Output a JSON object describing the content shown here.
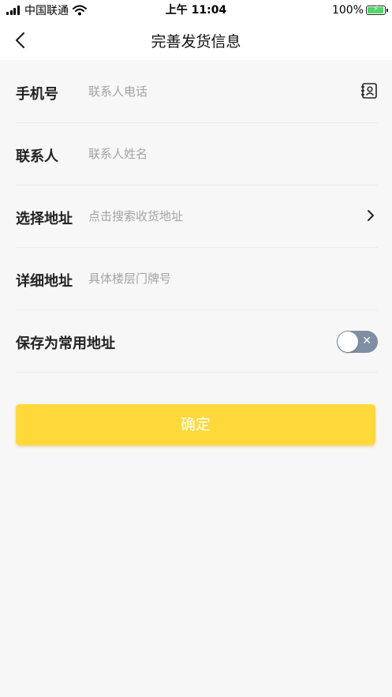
{
  "status_bar": {
    "carrier": "中国联通",
    "time": "上午 11:04",
    "battery": "100%",
    "battery_level": 1.0,
    "icons": [
      "signal-icon",
      "wifi-icon",
      "battery-icon"
    ]
  },
  "nav": {
    "title": "完善发货信息",
    "back_icon": "chevron-left-icon"
  },
  "form": {
    "phone": {
      "label": "手机号",
      "placeholder": "联系人电话",
      "value": "",
      "icon": "contact-book-icon"
    },
    "contact": {
      "label": "联系人",
      "placeholder": "联系人姓名",
      "value": ""
    },
    "address": {
      "label": "选择地址",
      "placeholder": "点击搜索收货地址",
      "value": "",
      "icon": "chevron-right-icon"
    },
    "detail": {
      "label": "详细地址",
      "placeholder": "具体楼层门牌号",
      "value": ""
    },
    "save_default": {
      "label": "保存为常用地址",
      "toggle_on": false,
      "toggle_symbol": "✕"
    }
  },
  "confirm": {
    "label": "确定"
  },
  "colors": {
    "accent": "#ffd93a",
    "toggle_off": "#7d8fa3",
    "placeholder": "#a3a3a3",
    "battery": "#4cd964"
  }
}
